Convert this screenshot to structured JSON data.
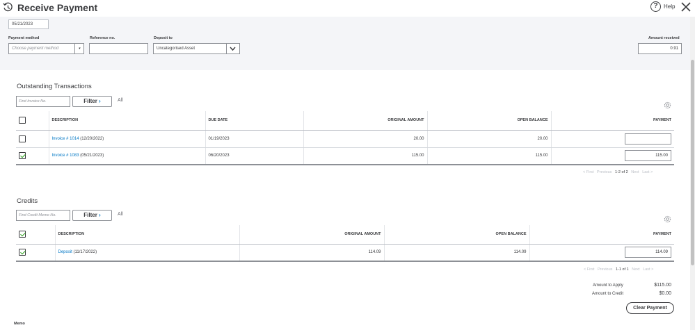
{
  "header": {
    "title": "Receive Payment",
    "help_label": "Help",
    "icons": [
      "history-icon",
      "help-icon",
      "close-icon"
    ]
  },
  "form": {
    "date": "05/21/2023",
    "payment_method": {
      "label": "Payment method",
      "placeholder": "Choose payment method"
    },
    "reference": {
      "label": "Reference no.",
      "value": ""
    },
    "deposit_to": {
      "label": "Deposit to",
      "value": "Uncategorised Asset"
    },
    "amount_received": {
      "label": "Amount received",
      "value": "0.91"
    }
  },
  "outstanding": {
    "title": "Outstanding Transactions",
    "find_placeholder": "Find Invoice No.",
    "filter_label": "Filter",
    "all_label": "All",
    "columns": [
      "DESCRIPTION",
      "DUE DATE",
      "ORIGINAL AMOUNT",
      "OPEN BALANCE",
      "PAYMENT"
    ],
    "rows": [
      {
        "checked": false,
        "link": "Invoice # 1014",
        "date_part": " (12/20/2022)",
        "due": "01/19/2023",
        "original": "20.00",
        "open": "20.00",
        "payment": ""
      },
      {
        "checked": true,
        "link": "Invoice # 1083",
        "date_part": " (05/21/2023)",
        "due": "06/20/2023",
        "original": "115.00",
        "open": "115.00",
        "payment": "115.00"
      }
    ],
    "pager": {
      "first": "< First",
      "previous": "Previous",
      "current": "1-2 of 2",
      "next": "Next",
      "last": "Last >"
    }
  },
  "credits": {
    "title": "Credits",
    "find_placeholder": "Find Credit Memo No.",
    "filter_label": "Filter",
    "all_label": "All",
    "columns": [
      "DESCRIPTION",
      "ORIGINAL AMOUNT",
      "OPEN BALANCE",
      "PAYMENT"
    ],
    "rows": [
      {
        "checked": true,
        "link": "Deposit",
        "date_part": " (11/17/2022)",
        "original": "114.09",
        "open": "114.09",
        "payment": "114.09"
      }
    ],
    "pager": {
      "first": "< First",
      "previous": "Previous",
      "current": "1-1 of 1",
      "next": "Next",
      "last": "Last >"
    }
  },
  "totals": {
    "apply_label": "Amount to Apply",
    "apply_value": "$115.00",
    "credit_label": "Amount to Credit",
    "credit_value": "$0.00",
    "clear_label": "Clear Payment"
  },
  "memo_label": "Memo",
  "colors": {
    "accent_link": "#0077c5",
    "check_green": "#2ca01c",
    "band_bg": "#f4f5f8"
  }
}
